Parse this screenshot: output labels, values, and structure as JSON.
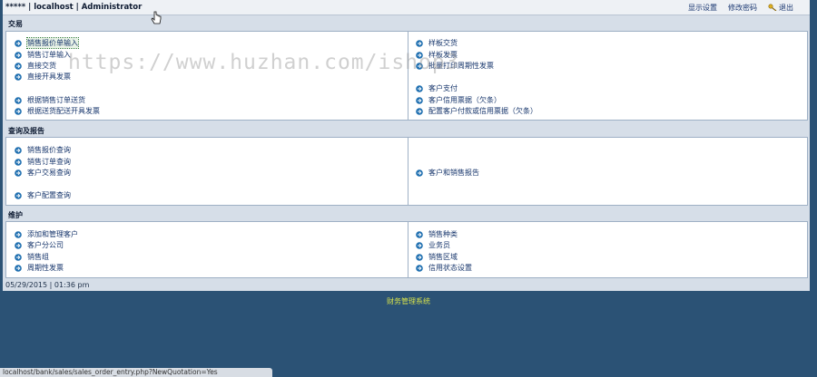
{
  "header": {
    "title": "***** | localhost | Administrator",
    "links": [
      {
        "label": "显示设置"
      },
      {
        "label": "修改密码"
      },
      {
        "label": "退出"
      }
    ]
  },
  "sections": [
    {
      "title": "交易",
      "left": [
        "销售报价单输入",
        "销售订单输入",
        "直接交货",
        "直接开具发票",
        "",
        "根据销售订单送货",
        "根据送货配送开具发票"
      ],
      "right": [
        "样板交货",
        "样板发票",
        "批量打印周期性发票",
        "",
        "客户支付",
        "客户信用票据（欠条）",
        "配置客户付款或信用票据（欠条）"
      ]
    },
    {
      "title": "查询及报告",
      "left": [
        "销售报价查询",
        "销售订单查询",
        "客户交易查询",
        "",
        "客户配置查询"
      ],
      "right": [
        "",
        "",
        "客户和销售报告"
      ]
    },
    {
      "title": "维护",
      "left": [
        "添加和管理客户",
        "客户分公司",
        "销售组",
        "周期性发票"
      ],
      "right": [
        "销售种类",
        "业务员",
        "销售区域",
        "信用状态设置"
      ]
    }
  ],
  "status": {
    "datetime": "05/29/2015 | 01:36 pm"
  },
  "footer": {
    "text": "财务管理系统"
  },
  "browser": {
    "status_url": "localhost/bank/sales/sales_order_entry.php?NewQuotation=Yes"
  },
  "watermark": {
    "text": "https://www.huzhan.com/ishop3"
  },
  "colors": {
    "background": "#2b5275",
    "panel": "#ffffff",
    "link": "#17366c",
    "footer_text": "#d8e34b",
    "arrow": "#1f6fb0"
  }
}
